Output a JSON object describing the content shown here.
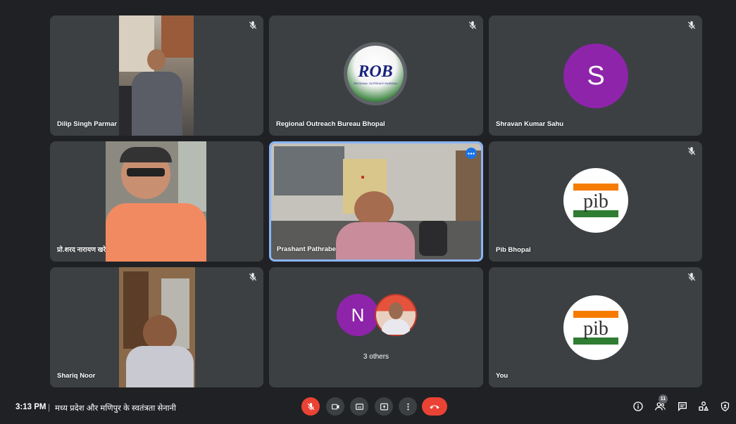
{
  "participants": [
    {
      "name": "Dilip Singh Parmar",
      "muted": true
    },
    {
      "name": "Regional Outreach Bureau Bhopal",
      "muted": true,
      "logo_text": "ROB",
      "logo_sub": "REGIONAL OUTREACH BUREAU"
    },
    {
      "name": "Shravan Kumar Sahu",
      "muted": true,
      "initial": "S",
      "color": "#8e24aa"
    },
    {
      "name": "प्रो.शरद नारायण खरे",
      "muted": false
    },
    {
      "name": "Prashant Pathrabe",
      "muted": false,
      "speaking": true
    },
    {
      "name": "Pib Bhopal",
      "muted": true,
      "logo_text": "pib"
    },
    {
      "name": "Shariq Noor",
      "muted": true
    },
    {
      "others_label": "3 others",
      "initial": "N",
      "color": "#8e24aa"
    },
    {
      "name": "You",
      "muted": true,
      "logo_text": "pib"
    }
  ],
  "bottom_bar": {
    "time": "3:13 PM",
    "separator": "|",
    "meeting_title": "मध्य प्रदेश और मणिपुर के स्वतंत्रता सेनानी",
    "controls": [
      "mic-off-icon",
      "camera-icon",
      "captions-icon",
      "present-icon",
      "more-icon",
      "hangup-icon"
    ],
    "right_icons": [
      "info-icon",
      "people-icon",
      "chat-icon",
      "activities-icon",
      "host-controls-icon"
    ],
    "people_count": "11"
  },
  "colors": {
    "background": "#202124",
    "tile": "#3c4043",
    "accent": "#8ab4f8",
    "danger": "#ea4335",
    "avatar": "#8e24aa"
  }
}
